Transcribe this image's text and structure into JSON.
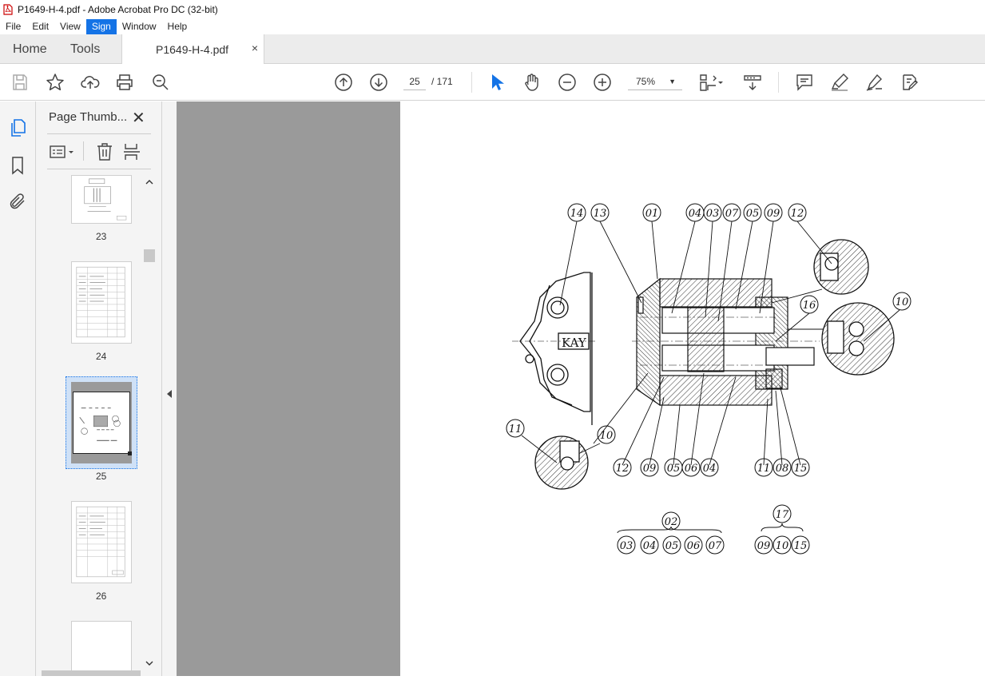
{
  "window": {
    "title": "P1649-H-4.pdf - Adobe Acrobat Pro DC (32-bit)"
  },
  "menu": [
    "File",
    "Edit",
    "View",
    "Sign",
    "Window",
    "Help"
  ],
  "tabs": {
    "home": "Home",
    "tools": "Tools",
    "document": "P1649-H-4.pdf",
    "close": "×"
  },
  "toolbar": {
    "page_current": "25",
    "page_total": "/ 171",
    "zoom": "75%",
    "icons": [
      "save-icon",
      "star-icon",
      "upload-icon",
      "print-icon",
      "zoom-search-icon",
      "arrow-up-icon",
      "arrow-down-icon",
      "cursor-icon",
      "hand-icon",
      "zoom-out-icon",
      "zoom-in-icon",
      "fit-page-icon",
      "scroll-mode-icon",
      "comment-icon",
      "highlight-icon",
      "sign-icon",
      "edit-icon"
    ]
  },
  "panel": {
    "title": "Page Thumb...",
    "close": "✕",
    "thumbnails": [
      {
        "label": "23"
      },
      {
        "label": "24"
      },
      {
        "label": "25",
        "selected": true
      },
      {
        "label": "26"
      }
    ]
  },
  "drawing": {
    "callouts_top": [
      "14",
      "13",
      "01",
      "04",
      "03",
      "07",
      "05",
      "09",
      "12"
    ],
    "callouts_bottom": [
      "12",
      "09",
      "05",
      "06",
      "04",
      "11",
      "08",
      "15"
    ],
    "callout_16": "16",
    "callout_10_right": "10",
    "callout_11_left": "11",
    "callout_10_left": "10",
    "nameplate": "KAY",
    "group_02_head": "02",
    "group_02_items": [
      "03",
      "04",
      "05",
      "06",
      "07"
    ],
    "group_17_head": "17",
    "group_17_items": [
      "09",
      "10",
      "15"
    ]
  }
}
